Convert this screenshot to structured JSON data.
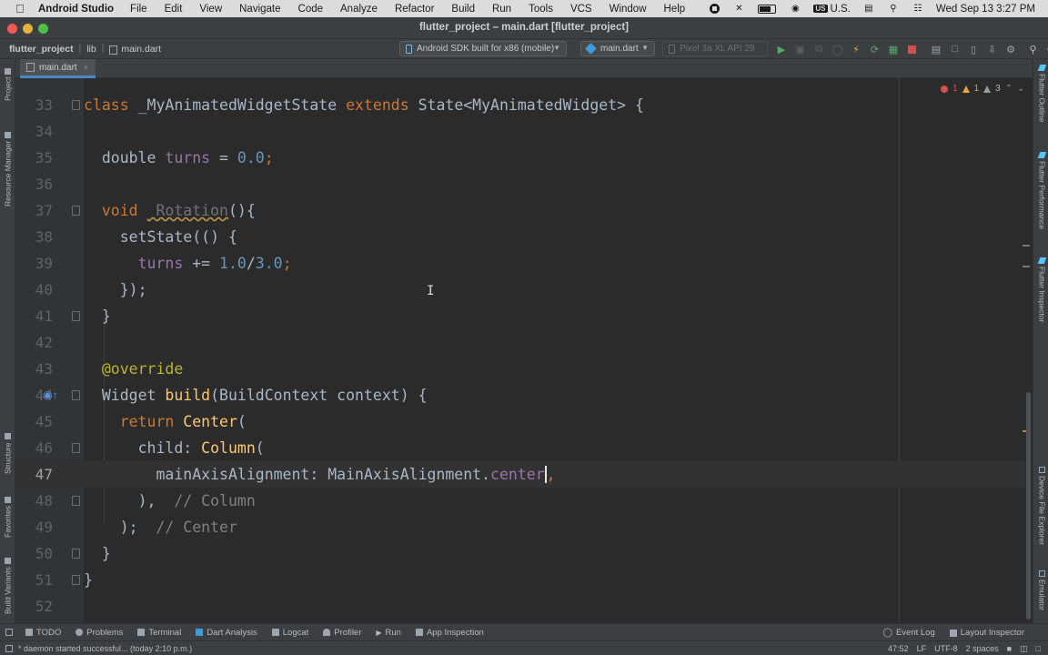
{
  "menubar": {
    "app_name": "Android Studio",
    "menus": [
      "File",
      "Edit",
      "View",
      "Navigate",
      "Code",
      "Analyze",
      "Refactor",
      "Build",
      "Run",
      "Tools",
      "VCS",
      "Window",
      "Help"
    ],
    "input_source": "U.S.",
    "input_flag": "US",
    "clock": "Wed Sep 13  3:27 PM"
  },
  "window": {
    "title": "flutter_project – main.dart [flutter_project]"
  },
  "navbar": {
    "project": "flutter_project",
    "folder": "lib",
    "file": "main.dart",
    "device": "Android SDK built for x86 (mobile)",
    "run_config": "main.dart",
    "avd": "Pixel 3a XL API 29"
  },
  "tab": {
    "label": "main.dart",
    "close": "×"
  },
  "left_tools": {
    "project": "Project",
    "resource_manager": "Resource Manager",
    "structure": "Structure",
    "favorites": "Favorites",
    "build_variants": "Build Variants"
  },
  "right_tools": {
    "flutter_outline": "Flutter Outline",
    "flutter_performance": "Flutter Performance",
    "flutter_inspector": "Flutter Inspector",
    "device_file_explorer": "Device File Explorer",
    "emulator": "Emulator"
  },
  "inspections": {
    "errors": "1",
    "warnings": "1",
    "weak_warnings": "3"
  },
  "code_lines": [
    {
      "n": "33",
      "t": "class _MyAnimatedWidgetState extends State<MyAnimatedWidget> {"
    },
    {
      "n": "34",
      "t": ""
    },
    {
      "n": "35",
      "t": "  double turns = 0.0;"
    },
    {
      "n": "36",
      "t": ""
    },
    {
      "n": "37",
      "t": "  void _Rotation(){"
    },
    {
      "n": "38",
      "t": "    setState(() {"
    },
    {
      "n": "39",
      "t": "      turns += 1.0/3.0;"
    },
    {
      "n": "40",
      "t": "    });"
    },
    {
      "n": "41",
      "t": "  }"
    },
    {
      "n": "42",
      "t": ""
    },
    {
      "n": "43",
      "t": "  @override"
    },
    {
      "n": "44",
      "t": "  Widget build(BuildContext context) {"
    },
    {
      "n": "45",
      "t": "    return Center("
    },
    {
      "n": "46",
      "t": "      child: Column("
    },
    {
      "n": "47",
      "t": "        mainAxisAlignment: MainAxisAlignment.center,"
    },
    {
      "n": "48",
      "t": "      ),  // Column"
    },
    {
      "n": "49",
      "t": "    );  // Center"
    },
    {
      "n": "50",
      "t": "  }"
    },
    {
      "n": "51",
      "t": "}"
    },
    {
      "n": "52",
      "t": ""
    }
  ],
  "tokens": {
    "l33": [
      "class",
      "_MyAnimatedWidgetState",
      "extends",
      "State<MyAnimatedWidget> {"
    ],
    "l35": [
      "double",
      "turns",
      "=",
      "0.0",
      ";"
    ],
    "l37": [
      "void",
      "_Rotation",
      "(){"
    ],
    "l38": [
      "setState",
      "(() {"
    ],
    "l39": [
      "turns",
      "+=",
      "1.0",
      "/",
      "3.0",
      ";"
    ],
    "l40": [
      "});"
    ],
    "l41": [
      "}"
    ],
    "l43": [
      "@override"
    ],
    "l44": [
      "Widget",
      "build",
      "(BuildContext context) {"
    ],
    "l45": [
      "return",
      "Center",
      "("
    ],
    "l46": [
      "child: ",
      "Column",
      "("
    ],
    "l47": [
      "mainAxisAlignment: MainAxisAlignment.",
      "center",
      ","
    ],
    "l48": [
      "),",
      "// Column"
    ],
    "l49": [
      ");",
      "// Center"
    ],
    "l50": [
      "}"
    ],
    "l51": [
      "}"
    ]
  },
  "bottom_tools": {
    "todo": "TODO",
    "problems": "Problems",
    "terminal": "Terminal",
    "dart_analysis": "Dart Analysis",
    "logcat": "Logcat",
    "profiler": "Profiler",
    "run": "Run",
    "app_inspection": "App Inspection",
    "event_log": "Event Log",
    "layout_inspector": "Layout Inspector"
  },
  "status": {
    "message": "* daemon started successful... (today 2:10 p.m.)",
    "position": "47:52",
    "line_sep": "LF",
    "encoding": "UTF-8",
    "indent": "2 spaces"
  },
  "colors": {
    "editor_bg": "#2b2b2b",
    "keyword": "#cc7832",
    "field": "#9876aa",
    "number": "#6897bb",
    "function": "#ffc66d",
    "comment": "#808080"
  }
}
